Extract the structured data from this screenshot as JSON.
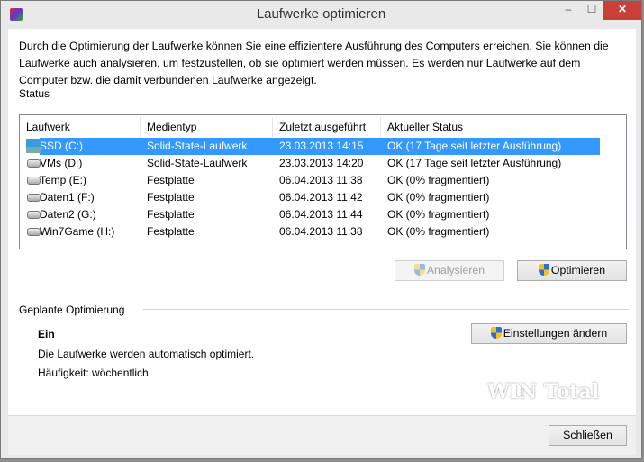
{
  "window": {
    "title": "Laufwerke optimieren",
    "minimize": "–",
    "maximize": "☐",
    "close": "✕"
  },
  "intro": "Durch die Optimierung der Laufwerke können Sie eine effizientere Ausführung des Computers erreichen. Sie können die Laufwerke auch analysieren, um festzustellen, ob sie optimiert werden müssen. Es werden nur Laufwerke auf dem Computer bzw. die damit verbundenen Laufwerke angezeigt.",
  "status": {
    "label": "Status",
    "columns": [
      "Laufwerk",
      "Medientyp",
      "Zuletzt ausgeführt",
      "Aktueller Status"
    ],
    "rows": [
      {
        "drive": "SSD (C:)",
        "type": "Solid-State-Laufwerk",
        "last": "23.03.2013 14:15",
        "state": "OK (17 Tage seit letzter Ausführung)",
        "selected": true,
        "icon": "system-drive-icon"
      },
      {
        "drive": "VMs (D:)",
        "type": "Solid-State-Laufwerk",
        "last": "23.03.2013 14:20",
        "state": "OK (17 Tage seit letzter Ausführung)",
        "icon": "drive-icon"
      },
      {
        "drive": "Temp (E:)",
        "type": "Festplatte",
        "last": "06.04.2013 11:38",
        "state": "OK (0% fragmentiert)",
        "icon": "drive-icon"
      },
      {
        "drive": "Daten1 (F:)",
        "type": "Festplatte",
        "last": "06.04.2013 11:42",
        "state": "OK (0% fragmentiert)",
        "icon": "drive-icon"
      },
      {
        "drive": "Daten2 (G:)",
        "type": "Festplatte",
        "last": "06.04.2013 11:44",
        "state": "OK (0% fragmentiert)",
        "icon": "drive-icon"
      },
      {
        "drive": "Win7Game (H:)",
        "type": "Festplatte",
        "last": "06.04.2013 11:38",
        "state": "OK (0% fragmentiert)",
        "icon": "drive-icon"
      }
    ],
    "analyze": "Analysieren",
    "optimize": "Optimieren"
  },
  "schedule": {
    "label": "Geplante Optimierung",
    "state": "Ein",
    "desc": "Die Laufwerke werden automatisch optimiert.",
    "frequency": "Häufigkeit: wöchentlich",
    "change": "Einstellungen ändern"
  },
  "watermark": "WIN Total",
  "close_button": "Schließen"
}
